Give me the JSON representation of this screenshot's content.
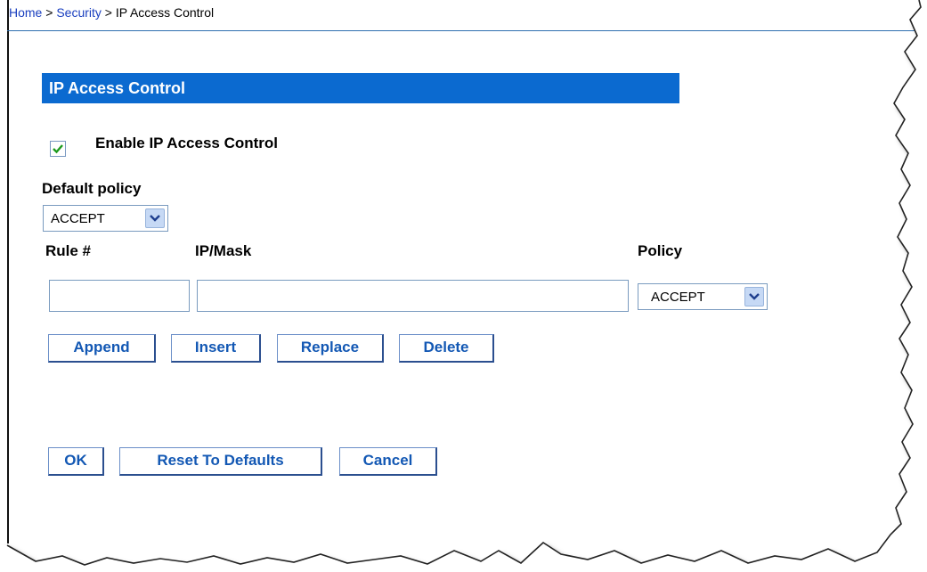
{
  "breadcrumb": {
    "home": "Home",
    "separator": ">",
    "security": "Security",
    "current": "IP Access Control"
  },
  "section": {
    "title": "IP Access Control"
  },
  "enable": {
    "label": "Enable IP Access Control",
    "checked": true
  },
  "default_policy": {
    "label": "Default policy",
    "value": "ACCEPT"
  },
  "rule_table": {
    "headers": {
      "rule": "Rule #",
      "ipmask": "IP/Mask",
      "policy": "Policy"
    },
    "rule_value": "",
    "ipmask_value": "",
    "policy_value": "ACCEPT"
  },
  "rule_buttons": {
    "append": "Append",
    "insert": "Insert",
    "replace": "Replace",
    "delete": "Delete"
  },
  "form_buttons": {
    "ok": "OK",
    "reset": "Reset To Defaults",
    "cancel": "Cancel"
  },
  "colors": {
    "header_bar": "#0b6ad0",
    "link": "#1a3fbf",
    "button_text": "#1358b4"
  },
  "icons": {
    "checkbox": "check-icon",
    "dropdown": "chevron-down-icon"
  }
}
